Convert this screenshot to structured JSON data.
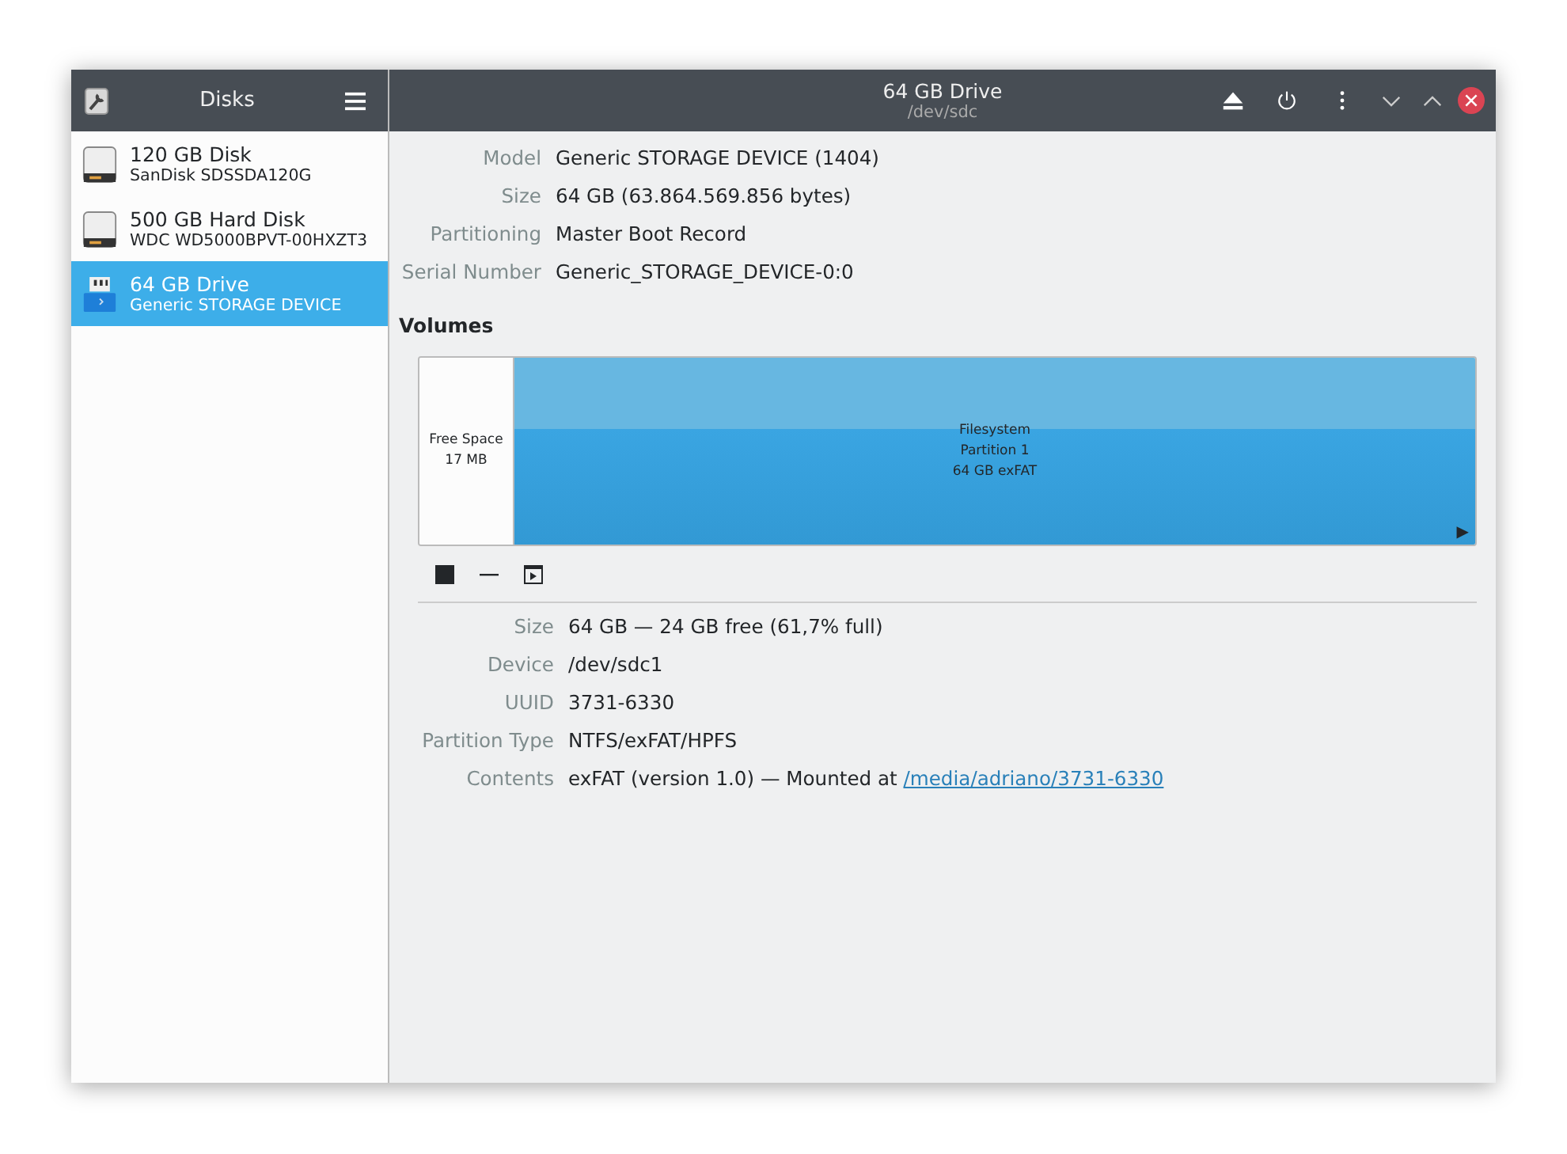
{
  "sidebar": {
    "title": "Disks",
    "items": [
      {
        "name": "120 GB Disk",
        "detail": "SanDisk SDSSDA120G",
        "kind": "disk",
        "selected": false
      },
      {
        "name": "500 GB Hard Disk",
        "detail": "WDC WD5000BPVT-00HXZT3",
        "kind": "disk",
        "selected": false
      },
      {
        "name": "64 GB Drive",
        "detail": "Generic STORAGE DEVICE",
        "kind": "usb",
        "selected": true
      }
    ]
  },
  "header": {
    "title": "64 GB Drive",
    "subtitle": "/dev/sdc"
  },
  "drive_info": [
    {
      "label": "Model",
      "value": "Generic STORAGE DEVICE (1404)"
    },
    {
      "label": "Size",
      "value": "64 GB (63.864.569.856 bytes)"
    },
    {
      "label": "Partitioning",
      "value": "Master Boot Record"
    },
    {
      "label": "Serial Number",
      "value": "Generic_STORAGE_DEVICE-0:0"
    }
  ],
  "volumes": {
    "title": "Volumes",
    "segments": [
      {
        "kind": "free",
        "lines": [
          "Free Space",
          "17 MB"
        ],
        "selected": false
      },
      {
        "kind": "partition",
        "lines": [
          "Filesystem",
          "Partition 1",
          "64 GB exFAT"
        ],
        "selected": true,
        "mounted_mark": "▶"
      }
    ],
    "info": [
      {
        "label": "Size",
        "value": "64 GB — 24 GB free (61,7% full)"
      },
      {
        "label": "Device",
        "value": "/dev/sdc1"
      },
      {
        "label": "UUID",
        "value": "3731-6330"
      },
      {
        "label": "Partition Type",
        "value": "NTFS/exFAT/HPFS"
      },
      {
        "label": "Contents",
        "value": "exFAT (version 1.0) — Mounted at ",
        "link": "/media/adriano/3731-6330"
      }
    ]
  }
}
